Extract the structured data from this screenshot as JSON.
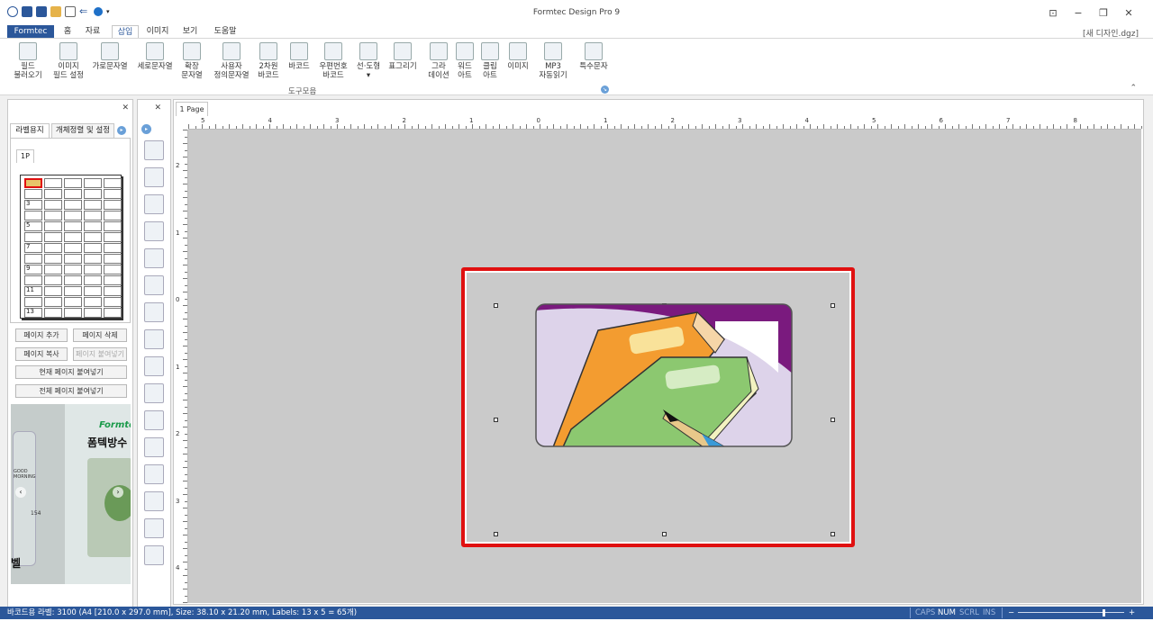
{
  "app": {
    "title": "Formtec Design Pro 9",
    "document_name": "[새 디자인.dgz]",
    "file_tab": "Formtec"
  },
  "ribbon_tabs": [
    "홈",
    "자료",
    "삽입",
    "이미지",
    "보기",
    "도움말"
  ],
  "active_tab": "삽입",
  "ribbon": {
    "buttons": [
      {
        "l1": "필드",
        "l2": "불러오기",
        "icon": "field-load-icon"
      },
      {
        "l1": "이미지",
        "l2": "필드 설정",
        "icon": "image-field-icon"
      },
      {
        "l1": "가로문자열",
        "l2": "",
        "icon": "horizontal-text-icon"
      },
      {
        "l1": "세로문자열",
        "l2": "",
        "icon": "vertical-text-icon"
      },
      {
        "l1": "확장",
        "l2": "문자열",
        "icon": "extended-text-icon"
      },
      {
        "l1": "사용자",
        "l2": "정의문자열",
        "icon": "custom-text-icon"
      },
      {
        "l1": "2차원",
        "l2": "바코드",
        "icon": "qr-code-icon"
      },
      {
        "l1": "바코드",
        "l2": "",
        "icon": "barcode-icon"
      },
      {
        "l1": "우편번호",
        "l2": "바코드",
        "icon": "postal-barcode-icon"
      },
      {
        "l1": "선·도형",
        "l2": "▾",
        "icon": "shape-icon"
      },
      {
        "l1": "표그리기",
        "l2": "",
        "icon": "table-icon"
      },
      {
        "l1": "그라",
        "l2": "데이션",
        "icon": "gradient-icon"
      },
      {
        "l1": "워드",
        "l2": "아트",
        "icon": "wordart-icon"
      },
      {
        "l1": "클립",
        "l2": "아트",
        "icon": "clipart-icon"
      },
      {
        "l1": "이미지",
        "l2": "",
        "icon": "image-icon"
      },
      {
        "l1": "MP3",
        "l2": "자동읽기",
        "icon": "mp3-icon"
      },
      {
        "l1": "특수문자",
        "l2": "",
        "icon": "special-char-icon"
      }
    ],
    "group_label": "도구모음"
  },
  "left_panel": {
    "tabs": [
      "라벨용지",
      "개체정렬 및 설정"
    ],
    "page_tab": "1P",
    "row_numbers": [
      "3",
      "5",
      "7",
      "9",
      "11",
      "13"
    ],
    "buttons": {
      "add_page": "페이지 추가",
      "delete_page": "페이지 삭제",
      "copy_page": "페이지 복사",
      "paste_page": "페이지 붙여넣기",
      "paste_current": "현재 페이지 붙여넣기",
      "paste_all": "전체 페이지 붙여넣기"
    },
    "ad": {
      "brand": "Formte",
      "text": "폼텍방수",
      "small": "GOOD\nMORNING",
      "num": "154",
      "bottom": "벨"
    }
  },
  "canvas": {
    "page_tab": "1 Page",
    "h_ruler_labels": [
      "5",
      "4",
      "3",
      "2",
      "1",
      "0",
      "1",
      "2",
      "3",
      "4",
      "5",
      "6",
      "7",
      "8"
    ],
    "v_ruler_labels": [
      "2",
      "1",
      "0",
      "1",
      "2",
      "3",
      "4"
    ]
  },
  "status": {
    "text": "바코드용 라벨: 3100 (A4 [210.0 x 297.0 mm], Size: 38.10 x 21.20 mm,  Labels: 13 x 5 = 65개)",
    "indicators": [
      "CAPS",
      "NUM",
      "SCRL",
      "INS"
    ],
    "active_indicator": "NUM",
    "zoom_minus": "−",
    "zoom_plus": "+",
    "zoom_level": 0.8
  },
  "colors": {
    "accent": "#2b579a",
    "selection_border": "#e01010",
    "book_orange": "#f39c30",
    "book_green": "#8cc870",
    "purple": "#7a1a7e"
  }
}
